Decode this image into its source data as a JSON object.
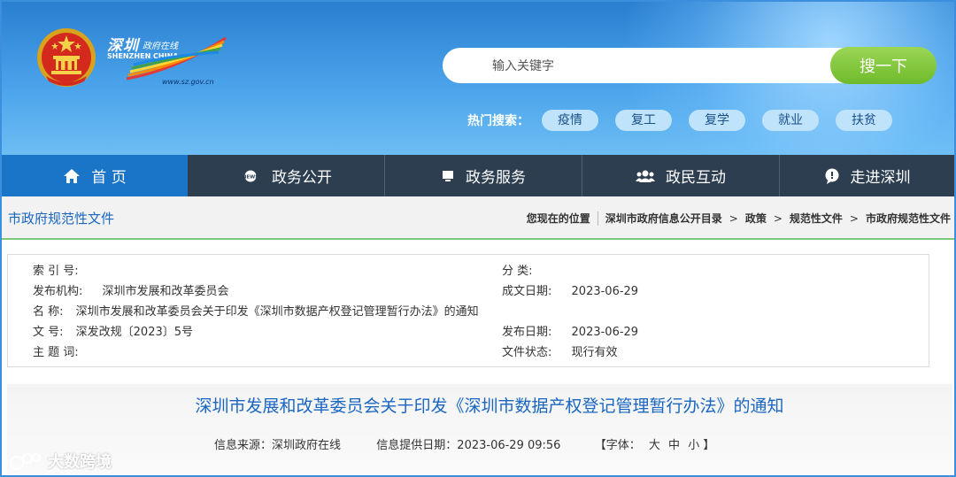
{
  "header": {
    "logo_cn": "深圳",
    "logo_cn2": "政府在线",
    "logo_en": "SHENZHEN CHINA",
    "logo_url": "www.sz.gov.cn",
    "search_placeholder": "输入关键字",
    "search_button": "搜一下",
    "hot_label": "热门搜索：",
    "hot_tags": [
      "疫情",
      "复工",
      "复学",
      "就业",
      "扶贫"
    ]
  },
  "nav": [
    {
      "label": "首 页",
      "icon": "home-icon",
      "active": true
    },
    {
      "label": "政务公开",
      "icon": "news-icon",
      "active": false
    },
    {
      "label": "政务服务",
      "icon": "monitor-icon",
      "active": false
    },
    {
      "label": "政民互动",
      "icon": "users-icon",
      "active": false
    },
    {
      "label": "走进深圳",
      "icon": "chat-icon",
      "active": false
    }
  ],
  "breadcrumb": {
    "section_title": "市政府规范性文件",
    "location_label": "您现在的位置",
    "items": [
      "深圳市政府信息公开目录",
      "政策",
      "规范性文件",
      "市政府规范性文件"
    ]
  },
  "info": {
    "index_label": "索 引 号:",
    "index_value": "",
    "category_label": "分 类:",
    "category_value": "",
    "issuer_label": "发布机构:",
    "issuer_value": "深圳市发展和改革委员会",
    "created_label": "成文日期:",
    "created_value": "2023-06-29",
    "name_label": "名 称:",
    "name_value": "深圳市发展和改革委员会关于印发《深圳市数据产权登记管理暂行办法》的通知",
    "docno_label": "文 号:",
    "docno_value": "深发改规〔2023〕5号",
    "published_label": "发布日期:",
    "published_value": "2023-06-29",
    "subject_label": "主 题 词:",
    "subject_value": "",
    "status_label": "文件状态:",
    "status_value": "现行有效"
  },
  "article": {
    "title": "深圳市发展和改革委员会关于印发《深圳市数据产权登记管理暂行办法》的通知",
    "source": "信息来源：深圳政府在线",
    "date": "信息提供日期：2023-06-29 09:56",
    "font_label": "【字体：",
    "font_large": "大",
    "font_medium": "中",
    "font_small": "小",
    "font_close": "】"
  },
  "watermark": "大数跨境",
  "colors": {
    "nav_bg": "#2c3e50",
    "nav_active": "#1a74c8",
    "link_blue": "#1a66c1",
    "search_green": "#7cc43e"
  }
}
